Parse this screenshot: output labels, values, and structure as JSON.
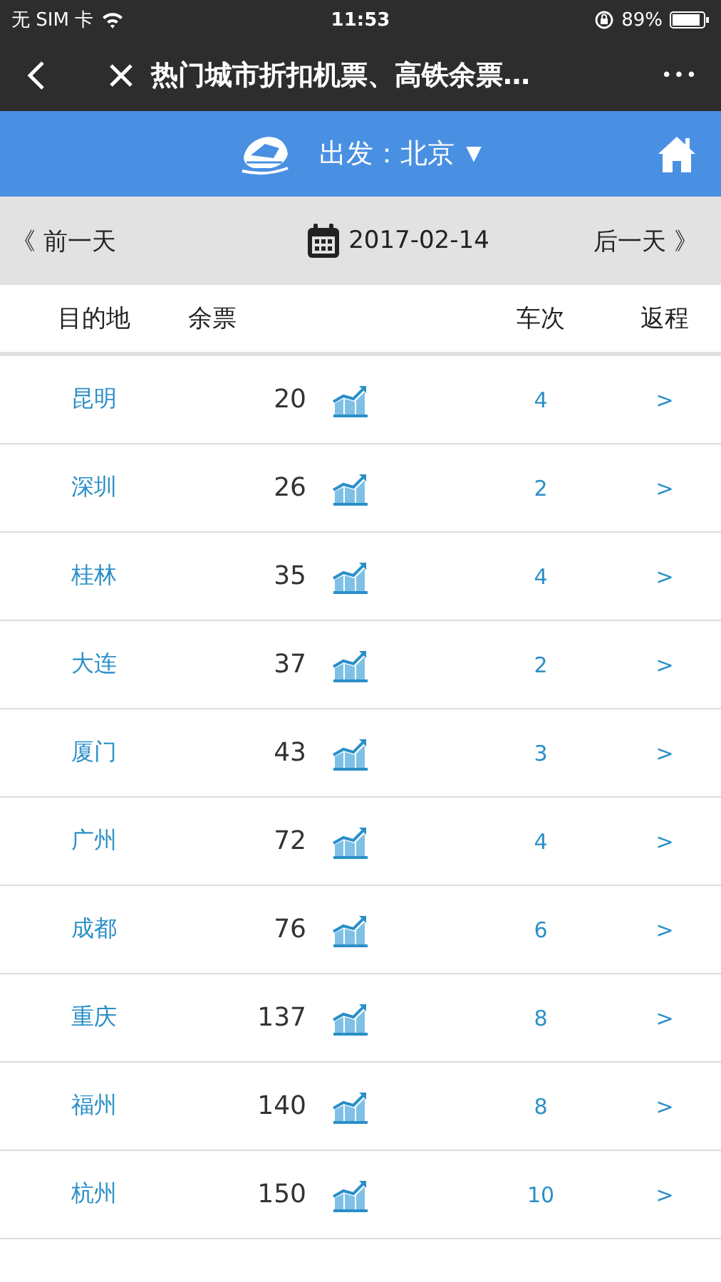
{
  "status_bar": {
    "carrier": "无 SIM 卡",
    "time": "11:53",
    "battery": "89%"
  },
  "nav": {
    "title": "热门城市折扣机票、高铁余票…",
    "more": "•••"
  },
  "header": {
    "departure": "出发：北京",
    "dropdown": "▼"
  },
  "date_bar": {
    "prev": "《 前一天",
    "date": "2017-02-14",
    "next": "后一天 》"
  },
  "table": {
    "columns": [
      "目的地",
      "余票",
      "车次",
      "返程"
    ],
    "rows": [
      {
        "city": "昆明",
        "tickets": "20",
        "trains": "4",
        "return": ">"
      },
      {
        "city": "深圳",
        "tickets": "26",
        "trains": "2",
        "return": ">"
      },
      {
        "city": "桂林",
        "tickets": "35",
        "trains": "4",
        "return": ">"
      },
      {
        "city": "大连",
        "tickets": "37",
        "trains": "2",
        "return": ">"
      },
      {
        "city": "厦门",
        "tickets": "43",
        "trains": "3",
        "return": ">"
      },
      {
        "city": "广州",
        "tickets": "72",
        "trains": "4",
        "return": ">"
      },
      {
        "city": "成都",
        "tickets": "76",
        "trains": "6",
        "return": ">"
      },
      {
        "city": "重庆",
        "tickets": "137",
        "trains": "8",
        "return": ">"
      },
      {
        "city": "福州",
        "tickets": "140",
        "trains": "8",
        "return": ">"
      },
      {
        "city": "杭州",
        "tickets": "150",
        "trains": "10",
        "return": ">"
      }
    ]
  }
}
